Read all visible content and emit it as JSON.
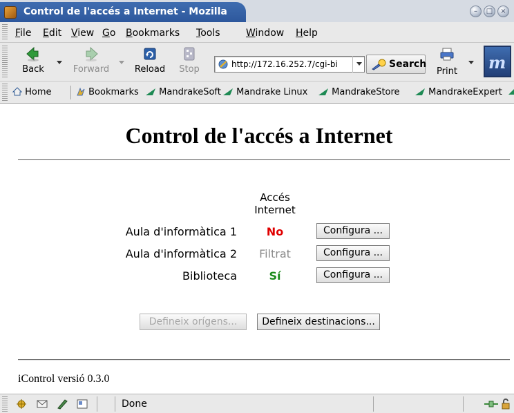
{
  "window": {
    "title": "Control de l'accés a Internet - Mozilla"
  },
  "menu": {
    "items": [
      {
        "label": "File",
        "accel": "F"
      },
      {
        "label": "Edit",
        "accel": "E"
      },
      {
        "label": "View",
        "accel": "V"
      },
      {
        "label": "Go",
        "accel": "G"
      },
      {
        "label": "Bookmarks",
        "accel": "B"
      },
      {
        "label": "Tools",
        "accel": "T"
      },
      {
        "label": "Window",
        "accel": "W"
      },
      {
        "label": "Help",
        "accel": "H"
      }
    ]
  },
  "toolbar": {
    "back_label": "Back",
    "forward_label": "Forward",
    "reload_label": "Reload",
    "stop_label": "Stop",
    "url_value": "http://172.16.252.7/cgi-bi",
    "search_label": "Search",
    "print_label": "Print"
  },
  "bookmarks_bar": {
    "home_label": "Home",
    "bookmarks_label": "Bookmarks",
    "items": [
      "MandrakeSoft",
      "Mandrake Linux",
      "MandrakeStore",
      "MandrakeExpert"
    ]
  },
  "page": {
    "title": "Control de l'accés a Internet",
    "column_header_line1": "Accés",
    "column_header_line2": "Internet",
    "rows": [
      {
        "label": "Aula d'informàtica 1",
        "status": "No",
        "status_color": "#e00000",
        "button_label": "Configura ..."
      },
      {
        "label": "Aula d'informàtica 2",
        "status": "Filtrat",
        "status_color": "#8a8a8a",
        "button_label": "Configura ..."
      },
      {
        "label": "Biblioteca",
        "status": "Sí",
        "status_color": "#1a8a1a",
        "button_label": "Configura ..."
      }
    ],
    "define_origins_label": "Defineix orígens...",
    "define_destinations_label": "Defineix destinacions...",
    "footer": "iControl versió 0.3.0"
  },
  "status_bar": {
    "text": "Done"
  }
}
